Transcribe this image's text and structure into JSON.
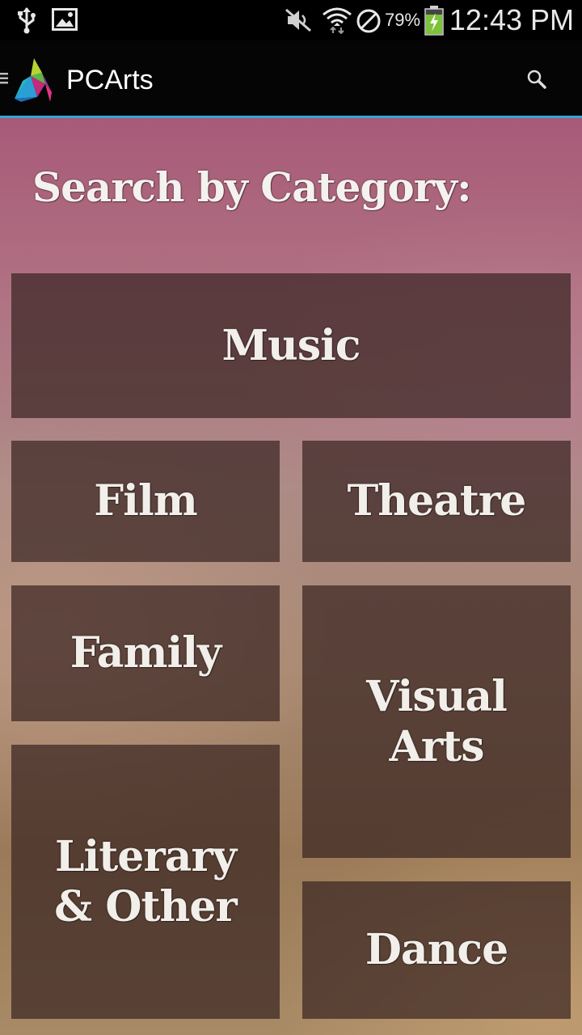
{
  "status_bar": {
    "battery_percent": "79%",
    "time": "12:43 PM"
  },
  "action_bar": {
    "title": "PCArts"
  },
  "page": {
    "heading": "Search by Category:"
  },
  "categories": {
    "music": "Music",
    "film": "Film",
    "theatre": "Theatre",
    "family": "Family",
    "visual_arts": "Visual\nArts",
    "literary": "Literary\n& Other",
    "dance": "Dance"
  }
}
